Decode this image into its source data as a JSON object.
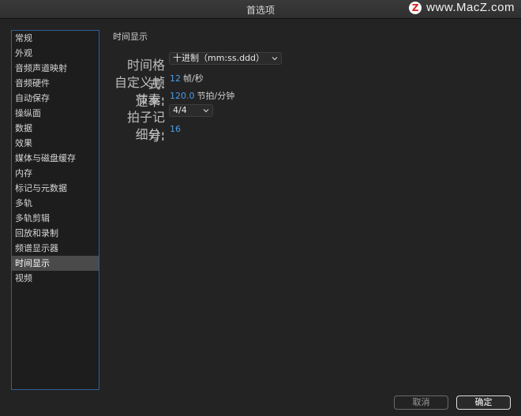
{
  "window": {
    "title": "首选项"
  },
  "watermark": {
    "logo_letter": "Z",
    "site": "www.MacZ.com"
  },
  "sidebar": {
    "items": [
      {
        "label": "常规"
      },
      {
        "label": "外观"
      },
      {
        "label": "音频声道映射"
      },
      {
        "label": "音频硬件"
      },
      {
        "label": "自动保存"
      },
      {
        "label": "操纵面"
      },
      {
        "label": "数据"
      },
      {
        "label": "效果"
      },
      {
        "label": "媒体与磁盘缓存"
      },
      {
        "label": "内存"
      },
      {
        "label": "标记与元数据"
      },
      {
        "label": "多轨"
      },
      {
        "label": "多轨剪辑"
      },
      {
        "label": "回放和录制"
      },
      {
        "label": "频谱显示器"
      },
      {
        "label": "时间显示",
        "active": true
      },
      {
        "label": "视频"
      }
    ]
  },
  "panel": {
    "title": "时间显示",
    "time_format": {
      "label": "时间格式:",
      "value": "十进制（mm:ss.ddd）"
    },
    "custom_fps": {
      "label": "自定义帧速率:",
      "value": "12",
      "unit": "帧/秒"
    },
    "tempo": {
      "label": "节奏:",
      "value": "120.0",
      "unit": "节拍/分钟"
    },
    "time_signature": {
      "label": "拍子记号:",
      "value": "4/4"
    },
    "subdivision": {
      "label": "细分:",
      "value": "16"
    }
  },
  "buttons": {
    "cancel": "取消",
    "ok": "确定"
  },
  "colors": {
    "accent_blue": "#4a9de6",
    "sidebar_border": "#2f5f9a",
    "active_item": "#4a4a4a"
  }
}
